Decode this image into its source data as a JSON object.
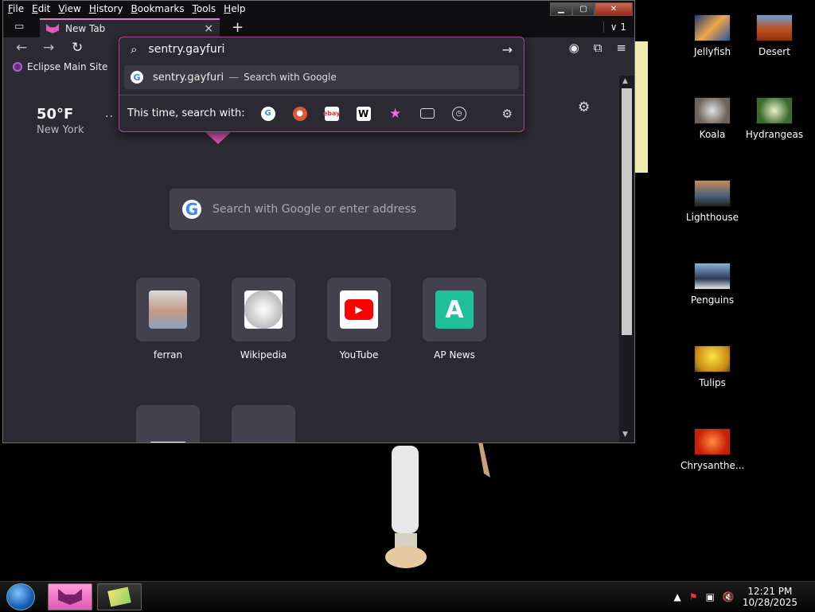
{
  "menubar": [
    "File",
    "Edit",
    "View",
    "History",
    "Bookmarks",
    "Tools",
    "Help"
  ],
  "tab": {
    "title": "New Tab"
  },
  "tab_count": "1",
  "bookmark": {
    "label": "Eclipse Main Site"
  },
  "urlbar": {
    "value": "sentry.gayfuri",
    "suggestion_text": "sentry.gayfuri",
    "suggestion_sep": "—",
    "suggestion_action": "Search with Google",
    "oneoff_label": "This time, search with:"
  },
  "weather": {
    "temp": "50°F",
    "city": "New York"
  },
  "newtab_search": {
    "placeholder": "Search with Google or enter address"
  },
  "top_sites": [
    {
      "label": "ferran"
    },
    {
      "label": "Wikipedia"
    },
    {
      "label": "YouTube"
    },
    {
      "label": "AP News"
    }
  ],
  "desktop_icons": [
    {
      "label": "Jellyfish"
    },
    {
      "label": "Desert"
    },
    {
      "label": "Koala"
    },
    {
      "label": "Hydrangeas"
    },
    {
      "label": "Lighthouse"
    },
    {
      "label": "Penguins"
    },
    {
      "label": "Tulips"
    },
    {
      "label": "Chrysanthe..."
    }
  ],
  "clock": {
    "time": "12:21 PM",
    "date": "10/28/2025"
  },
  "colors": {
    "accent": "#e05ab8",
    "window_bg": "#2b2a33",
    "popup_border": "#a14a8f"
  }
}
